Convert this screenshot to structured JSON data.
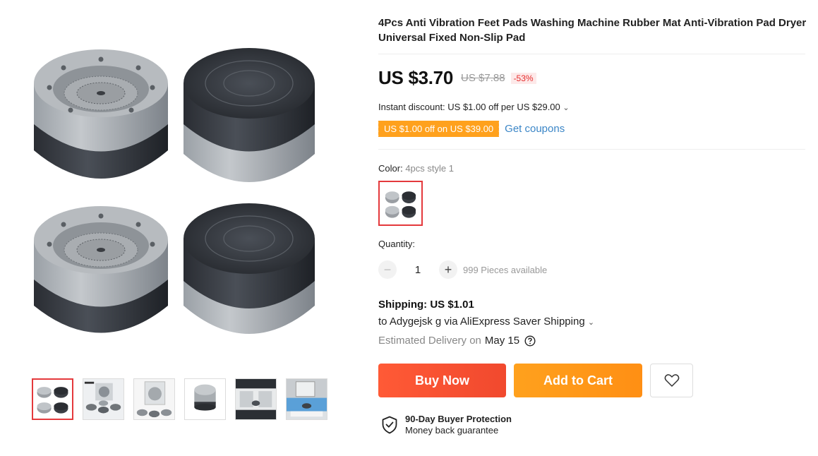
{
  "product": {
    "title": "4Pcs Anti Vibration Feet Pads Washing Machine Rubber Mat Anti-Vibration Pad Dryer Universal Fixed Non-Slip Pad"
  },
  "price": {
    "current": "US $3.70",
    "original": "US $7.88",
    "discount": "-53%"
  },
  "discount": {
    "instant": "Instant discount: US $1.00 off per US $29.00",
    "coupon": "US $1.00 off on US $39.00",
    "get_coupons": "Get coupons"
  },
  "color": {
    "label": "Color:",
    "selected": "4pcs style 1"
  },
  "quantity": {
    "label": "Quantity:",
    "value": "1",
    "minus": "−",
    "plus": "+",
    "available": "999 Pieces available"
  },
  "shipping": {
    "title": "Shipping: US $1.01",
    "to": "to Adygejsk g via AliExpress Saver Shipping",
    "delivery_label": "Estimated Delivery on",
    "delivery_date": "May 15"
  },
  "actions": {
    "buy_now": "Buy Now",
    "add_to_cart": "Add to Cart"
  },
  "protection": {
    "title": "90-Day Buyer Protection",
    "subtitle": "Money back guarantee"
  },
  "icons": {
    "chevron": "chevron-down-icon",
    "help": "question-circle-icon",
    "wishlist": "heart-icon",
    "protection": "shield-check-icon"
  },
  "colors": {
    "buy_now": "#f1492e",
    "add_to_cart": "#ff9a1a",
    "coupon": "#ffa11d",
    "link": "#3b86c7",
    "selected_border": "#e4393c"
  }
}
